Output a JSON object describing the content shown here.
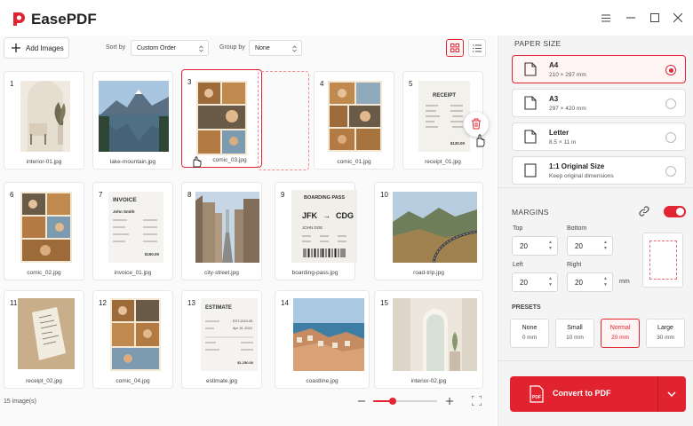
{
  "app": {
    "title": "EasePDF",
    "brand_color": "#e0232f"
  },
  "window_controls": {
    "menu": "hamburger-icon",
    "minimize": "minimize-icon",
    "maximize": "maximize-icon",
    "close": "close-icon"
  },
  "toolbar": {
    "add_label": "Add Images",
    "sort_label": "Sort by",
    "sort_value": "Custom Order",
    "group_label": "Group by",
    "group_value": "None",
    "view_grid": "grid-view-icon",
    "view_list": "list-view-icon"
  },
  "images": [
    {
      "num": "1",
      "name": "interior-01.jpg"
    },
    {
      "num": "2",
      "name": "lake-mountain.jpg"
    },
    {
      "num": "3",
      "name": "comic_03.jpg"
    },
    {
      "num": "4",
      "name": "comic_01.jpg"
    },
    {
      "num": "5",
      "name": "receipt_01.jpg"
    },
    {
      "num": "6",
      "name": "comic_02.jpg"
    },
    {
      "num": "7",
      "name": "invoice_01.jpg"
    },
    {
      "num": "8",
      "name": "city-street.jpg"
    },
    {
      "num": "9",
      "name": "boarding-pass.jpg"
    },
    {
      "num": "10",
      "name": "road-trip.jpg"
    },
    {
      "num": "11",
      "name": "receipt_02.jpg"
    },
    {
      "num": "12",
      "name": "comic_04.jpg"
    },
    {
      "num": "13",
      "name": "estimate.jpg"
    },
    {
      "num": "14",
      "name": "coastline.jpg"
    },
    {
      "num": "15",
      "name": "interior-02.jpg"
    }
  ],
  "thumb_text": {
    "receipt_title": "RECEIPT",
    "invoice_title": "INVOICE",
    "invoice_name": "John Smith",
    "invoice_total": "$150.00",
    "boarding_title": "BOARDING PASS",
    "boarding_from": "JFK",
    "boarding_to": "CDG",
    "boarding_name": "JOHN DOE",
    "receipt_total": "$130.00",
    "estimate_title": "ESTIMATE",
    "estimate_no": "EST-2024-35",
    "estimate_date": "Apr 10, 2024",
    "estimate_total": "$1,150.00"
  },
  "status": {
    "count": "15 image(s)",
    "zoom_fraction": 0.3
  },
  "panel": {
    "paper_size_title": "PAPER SIZE",
    "papers": [
      {
        "title": "A4",
        "sub": "210 × 297 mm",
        "selected": true
      },
      {
        "title": "A3",
        "sub": "297 × 420 mm",
        "selected": false
      },
      {
        "title": "Letter",
        "sub": "8.5 × 11 in",
        "selected": false
      },
      {
        "title": "1:1 Original Size",
        "sub": "Keep original dimensions",
        "selected": false
      }
    ],
    "margins_title": "MARGINS",
    "margins_linked": true,
    "margins_toggle": true,
    "top_label": "Top",
    "top_value": "20",
    "bottom_label": "Bottom",
    "bottom_value": "20",
    "left_label": "Left",
    "left_value": "20",
    "right_label": "Right",
    "right_value": "20",
    "unit": "mm",
    "presets_title": "PRESETS",
    "presets": [
      {
        "name": "None",
        "value": "0 mm",
        "selected": false
      },
      {
        "name": "Small",
        "value": "10 mm",
        "selected": false
      },
      {
        "name": "Normal",
        "value": "20 mm",
        "selected": true
      },
      {
        "name": "Large",
        "value": "30 mm",
        "selected": false
      }
    ],
    "convert_label": "Convert to PDF"
  }
}
